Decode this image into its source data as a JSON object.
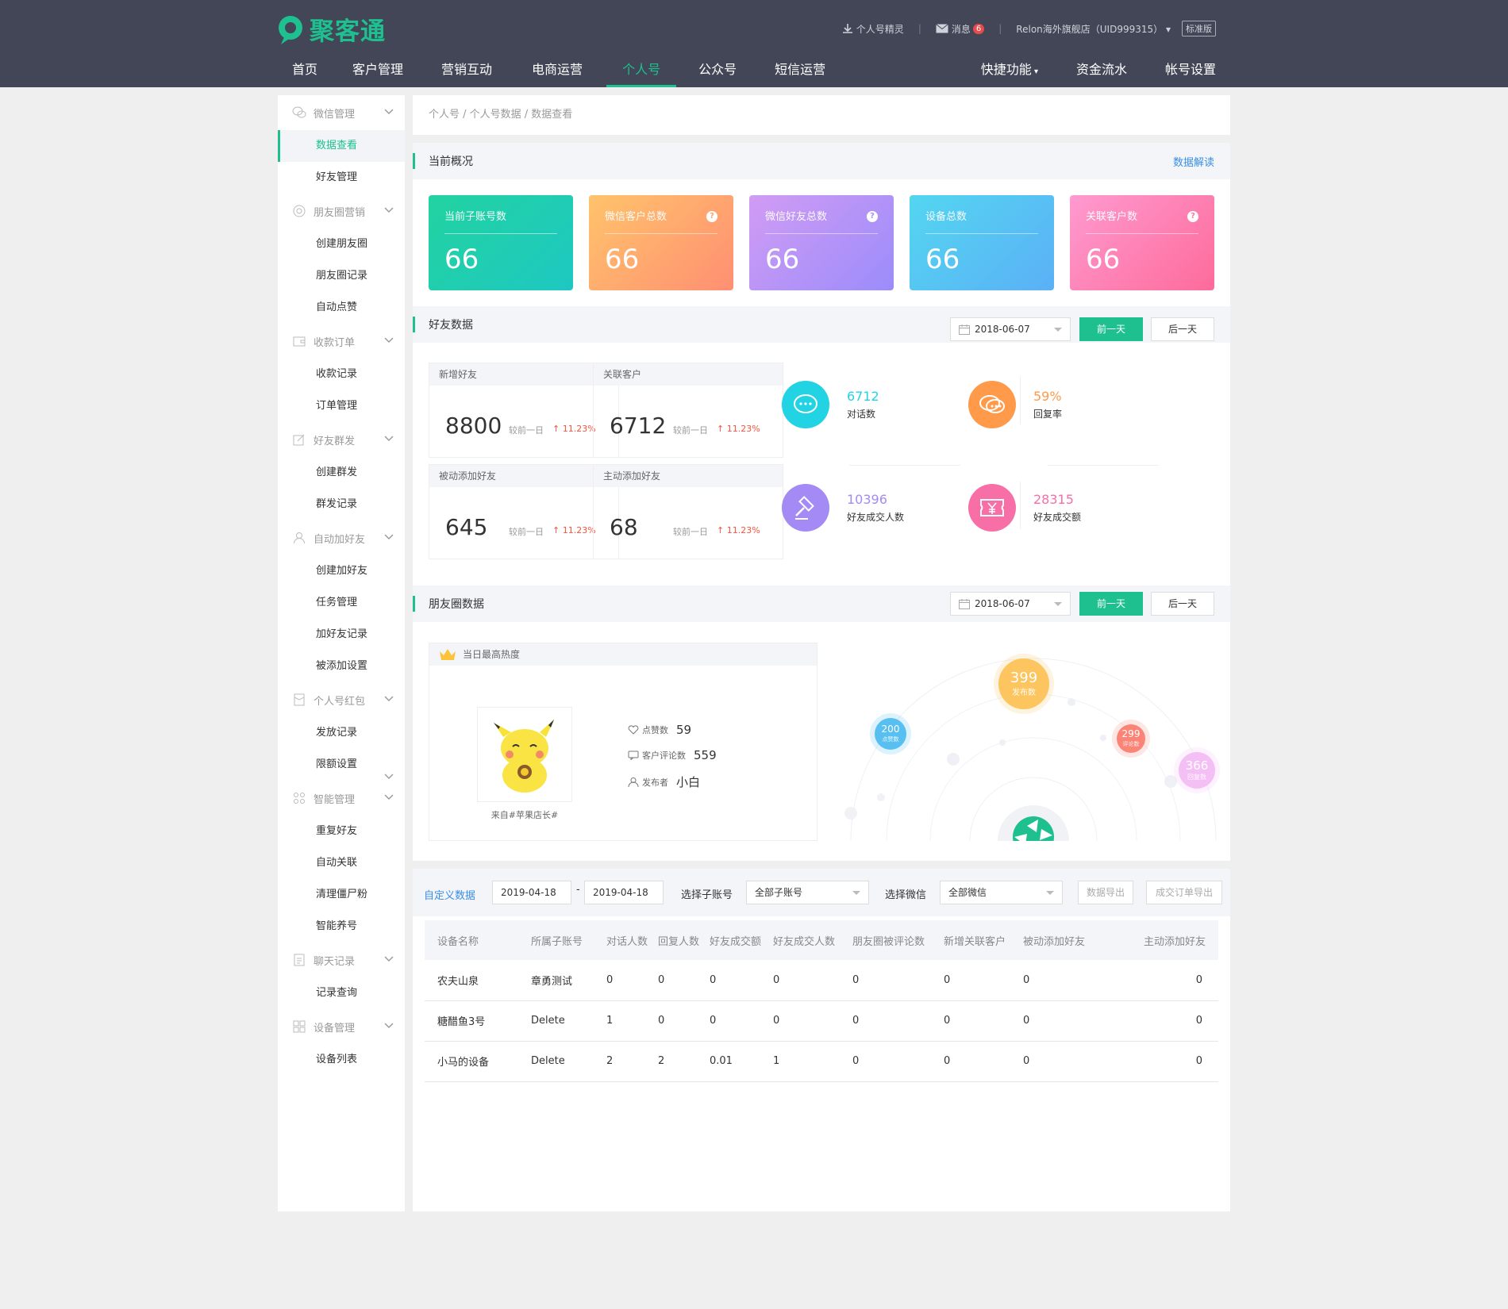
{
  "app": {
    "brand": "聚客通"
  },
  "topbar": {
    "download": "个人号精灵",
    "messages": "消息",
    "msg_count": "6",
    "account": "Relon海外旗舰店（UID999315）",
    "version": "标准版"
  },
  "nav": {
    "items": [
      "首页",
      "客户管理",
      "营销互动",
      "电商运营",
      "个人号",
      "公众号",
      "短信运营"
    ],
    "active": "个人号",
    "right": [
      "快捷功能",
      "资金流水",
      "帐号设置"
    ]
  },
  "sidebar": {
    "groups": [
      {
        "label": "微信管理",
        "icon": "wechat-icon",
        "items": [
          "数据查看",
          "好友管理"
        ]
      },
      {
        "label": "朋友圈营销",
        "icon": "moments-icon",
        "items": [
          "创建朋友圈",
          "朋友圈记录",
          "自动点赞"
        ]
      },
      {
        "label": "收款订单",
        "icon": "wallet-icon",
        "items": [
          "收款记录",
          "订单管理"
        ]
      },
      {
        "label": "好友群发",
        "icon": "edit-icon",
        "items": [
          "创建群发",
          "群发记录"
        ]
      },
      {
        "label": "自动加好友",
        "icon": "user-icon",
        "items": [
          "创建加好友",
          "任务管理",
          "加好友记录",
          "被添加设置"
        ]
      },
      {
        "label": "个人号红包",
        "icon": "redpacket-icon",
        "items": [
          "发放记录",
          "限额设置"
        ]
      },
      {
        "label": "智能管理",
        "icon": "smart-icon",
        "items": [
          "重复好友",
          "自动关联",
          "清理僵尸粉",
          "智能养号"
        ]
      },
      {
        "label": "聊天记录",
        "icon": "chat-record-icon",
        "items": [
          "记录查询"
        ]
      },
      {
        "label": "设备管理",
        "icon": "device-icon",
        "items": [
          "设备列表"
        ]
      }
    ],
    "active": "数据查看"
  },
  "breadcrumb": "个人号 / 个人号数据 / 数据查看",
  "overview": {
    "title": "当前概况",
    "link": "数据解读",
    "cards": [
      {
        "label": "当前子账号数",
        "value": "66",
        "help": false,
        "color": "#1fc9a3"
      },
      {
        "label": "微信客户总数",
        "value": "66",
        "help": true,
        "color": "#ffa26b"
      },
      {
        "label": "微信好友总数",
        "value": "66",
        "help": true,
        "color": "#b08cf8"
      },
      {
        "label": "设备总数",
        "value": "66",
        "help": false,
        "color": "#5bc3f2"
      },
      {
        "label": "关联客户数",
        "value": "66",
        "help": true,
        "color": "#fd77a5"
      }
    ]
  },
  "friends": {
    "title": "好友数据",
    "date": "2018-06-07",
    "prev": "前一天",
    "next": "后一天",
    "compare": "较前一日",
    "boxes": [
      {
        "label": "新增好友",
        "value": "8800",
        "pct": "11.23%"
      },
      {
        "label": "关联客户",
        "value": "6712",
        "pct": "11.23%"
      },
      {
        "label": "被动添加好友",
        "value": "645",
        "pct": "11.23%"
      },
      {
        "label": "主动添加好友",
        "value": "68",
        "pct": "11.23%"
      }
    ],
    "stats": [
      {
        "value": "6712",
        "label": "对话数",
        "color": "#22d3e3",
        "icon": "chat-bubble-icon"
      },
      {
        "value": "59%",
        "label": "回复率",
        "color": "#ff9a4a",
        "icon": "reply-bubble-icon"
      },
      {
        "value": "10396",
        "label": "好友成交人数",
        "color": "#a38af4",
        "icon": "gavel-icon"
      },
      {
        "value": "28315",
        "label": "好友成交额",
        "color": "#f86fa8",
        "icon": "yen-icon"
      }
    ]
  },
  "moments": {
    "title": "朋友圈数据",
    "date": "2018-06-07",
    "prev": "前一天",
    "next": "后一天",
    "hot_title": "当日最高热度",
    "source": "来自#苹果店长#",
    "likes_label": "点赞数",
    "likes": "59",
    "comments_label": "客户评论数",
    "comments": "559",
    "author_label": "发布者",
    "author": "小白",
    "bubbles": [
      {
        "value": "399",
        "label": "发布数",
        "color": "#fcc55f"
      },
      {
        "value": "200",
        "label": "点赞数",
        "color": "#57c0f0"
      },
      {
        "value": "299",
        "label": "评论数",
        "color": "#fb8476"
      },
      {
        "value": "366",
        "label": "回复数",
        "color": "#f4bff5"
      }
    ]
  },
  "custom": {
    "label": "自定义数据",
    "date_from": "2019-04-18",
    "date_sep": "-",
    "date_to": "2019-04-18",
    "sub_label": "选择子账号",
    "sub_value": "全部子账号",
    "wx_label": "选择微信",
    "wx_value": "全部微信",
    "export": "数据导出",
    "order_export": "成交订单导出",
    "columns": [
      "设备名称",
      "所属子账号",
      "对话人数",
      "回复人数",
      "好友成交额",
      "好友成交人数",
      "朋友圈被评论数",
      "新增关联客户",
      "被动添加好友",
      "主动添加好友"
    ],
    "rows": [
      [
        "农夫山泉",
        "章勇测试",
        "0",
        "0",
        "0",
        "0",
        "0",
        "0",
        "0",
        "0"
      ],
      [
        "糖醋鱼3号",
        "Delete",
        "1",
        "0",
        "0",
        "0",
        "0",
        "0",
        "0",
        "0"
      ],
      [
        "小马的设备",
        "Delete",
        "2",
        "2",
        "0.01",
        "1",
        "0",
        "0",
        "0",
        "0"
      ]
    ]
  }
}
